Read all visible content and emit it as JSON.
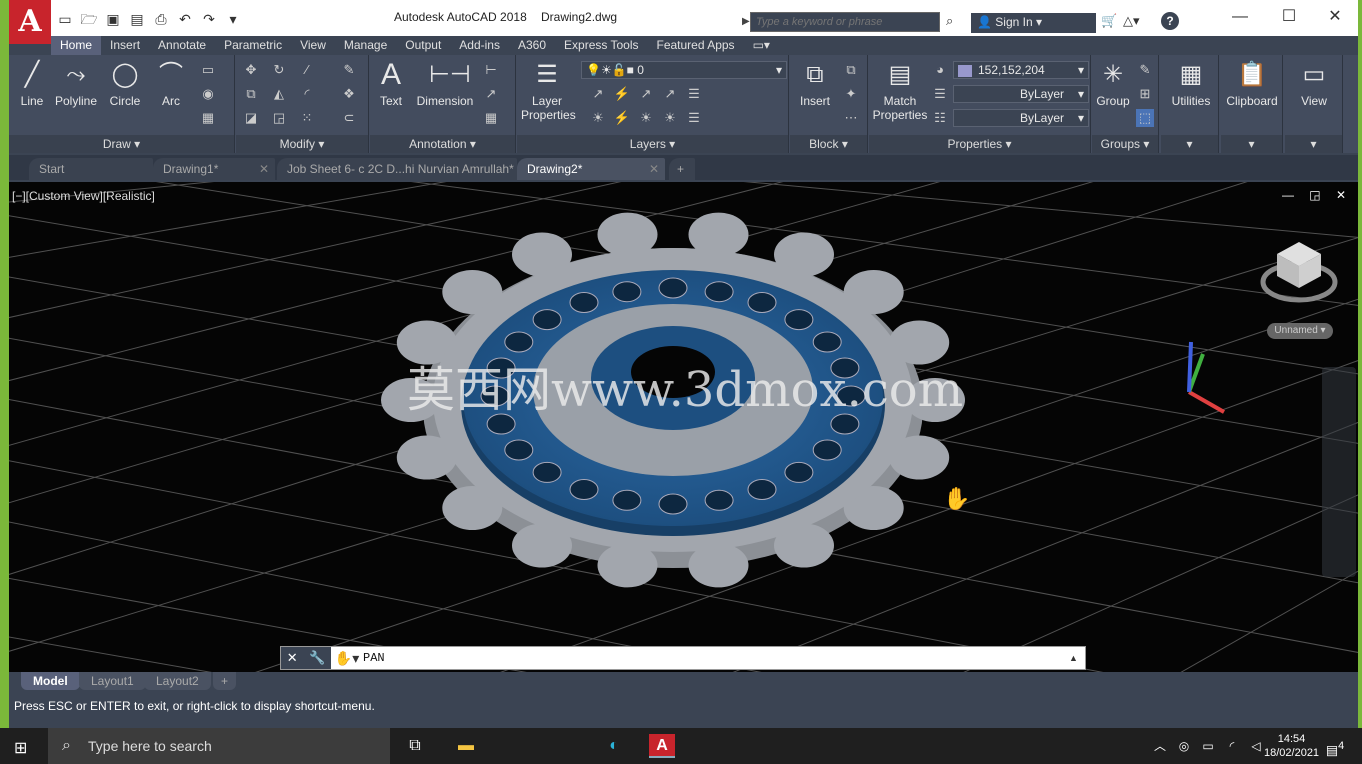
{
  "titlebar": {
    "app_logo": "A",
    "app_name": "Autodesk AutoCAD 2018",
    "document": "Drawing2.dwg",
    "search_placeholder": "Type a keyword or phrase",
    "sign_in": "Sign In"
  },
  "ribbon_tabs": [
    "Home",
    "Insert",
    "Annotate",
    "Parametric",
    "View",
    "Manage",
    "Output",
    "Add-ins",
    "A360",
    "Express Tools",
    "Featured Apps"
  ],
  "ribbon": {
    "draw": {
      "title": "Draw",
      "line": "Line",
      "polyline": "Polyline",
      "circle": "Circle",
      "arc": "Arc"
    },
    "modify": {
      "title": "Modify"
    },
    "annotation": {
      "title": "Annotation",
      "text": "Text",
      "dimension": "Dimension"
    },
    "layers": {
      "title": "Layers",
      "layer_properties_1": "Layer",
      "layer_properties_2": "Properties",
      "current_layer": "0"
    },
    "block": {
      "title": "Block",
      "insert": "Insert"
    },
    "properties": {
      "title": "Properties",
      "match_1": "Match",
      "match_2": "Properties",
      "color": "152,152,204",
      "color_hex": "#9898cc",
      "linetype": "ByLayer",
      "lineweight": "ByLayer"
    },
    "groups": {
      "title": "Groups",
      "group": "Group"
    },
    "utilities": "Utilities",
    "clipboard": "Clipboard",
    "view": "View"
  },
  "doc_tabs": [
    "Start",
    "Drawing1*",
    "Job Sheet  6- c 2C D...hi Nurvian Amrullah*",
    "Drawing2*"
  ],
  "viewport": {
    "label": "[−][Custom View][Realistic]",
    "watermark": "莫西网www.3dmox.com",
    "viewcube_label": "Unnamed"
  },
  "command_line": {
    "text": "PAN"
  },
  "layout_tabs": [
    "Model",
    "Layout1",
    "Layout2"
  ],
  "status_message": "Press ESC or ENTER to exit, or right-click to display shortcut-menu.",
  "taskbar": {
    "search_placeholder": "Type here to search",
    "time": "14:54",
    "date": "18/02/2021",
    "notifications": "4"
  },
  "colors": {
    "gear_grey": "#a2a6ad",
    "disc_blue": "#1d4f80",
    "accent_red": "#c8242c",
    "desktop_green": "#7bb83a"
  }
}
